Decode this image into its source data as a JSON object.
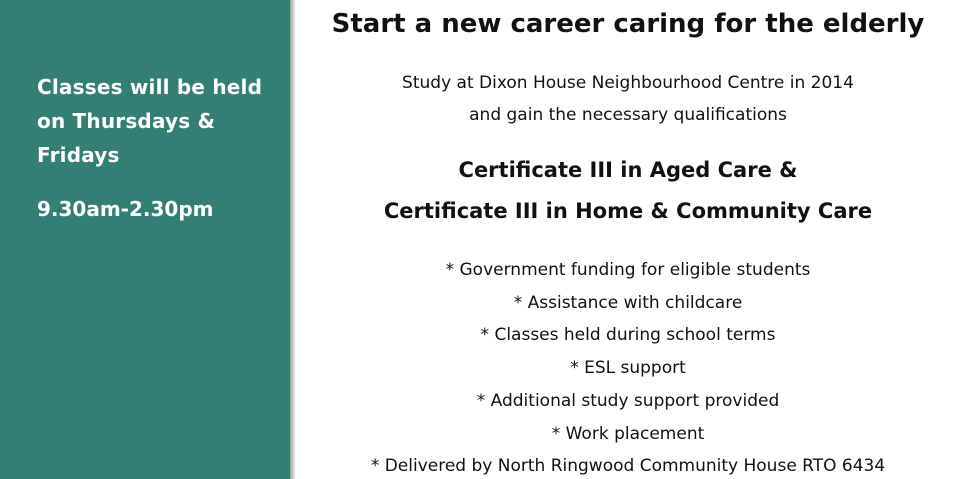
{
  "sidebar": {
    "lines": [
      "Classes will be held",
      "on Thursdays &",
      "Fridays"
    ],
    "time": "9.30am-2.30pm",
    "background_color": "#347f73"
  },
  "main": {
    "headline": "Start a new career caring for the elderly",
    "intro": [
      "Study at Dixon House Neighbourhood Centre in 2014",
      "and gain the necessary qualifications"
    ],
    "certificates": [
      "Certificate III in Aged Care &",
      "Certificate III in Home & Community Care"
    ],
    "benefits": [
      "* Government funding for eligible students",
      "* Assistance with childcare",
      "* Classes held during school terms",
      "* ESL support",
      "* Additional study support provided",
      "* Work placement",
      "* Delivered by North Ringwood Community House RTO 6434"
    ]
  }
}
